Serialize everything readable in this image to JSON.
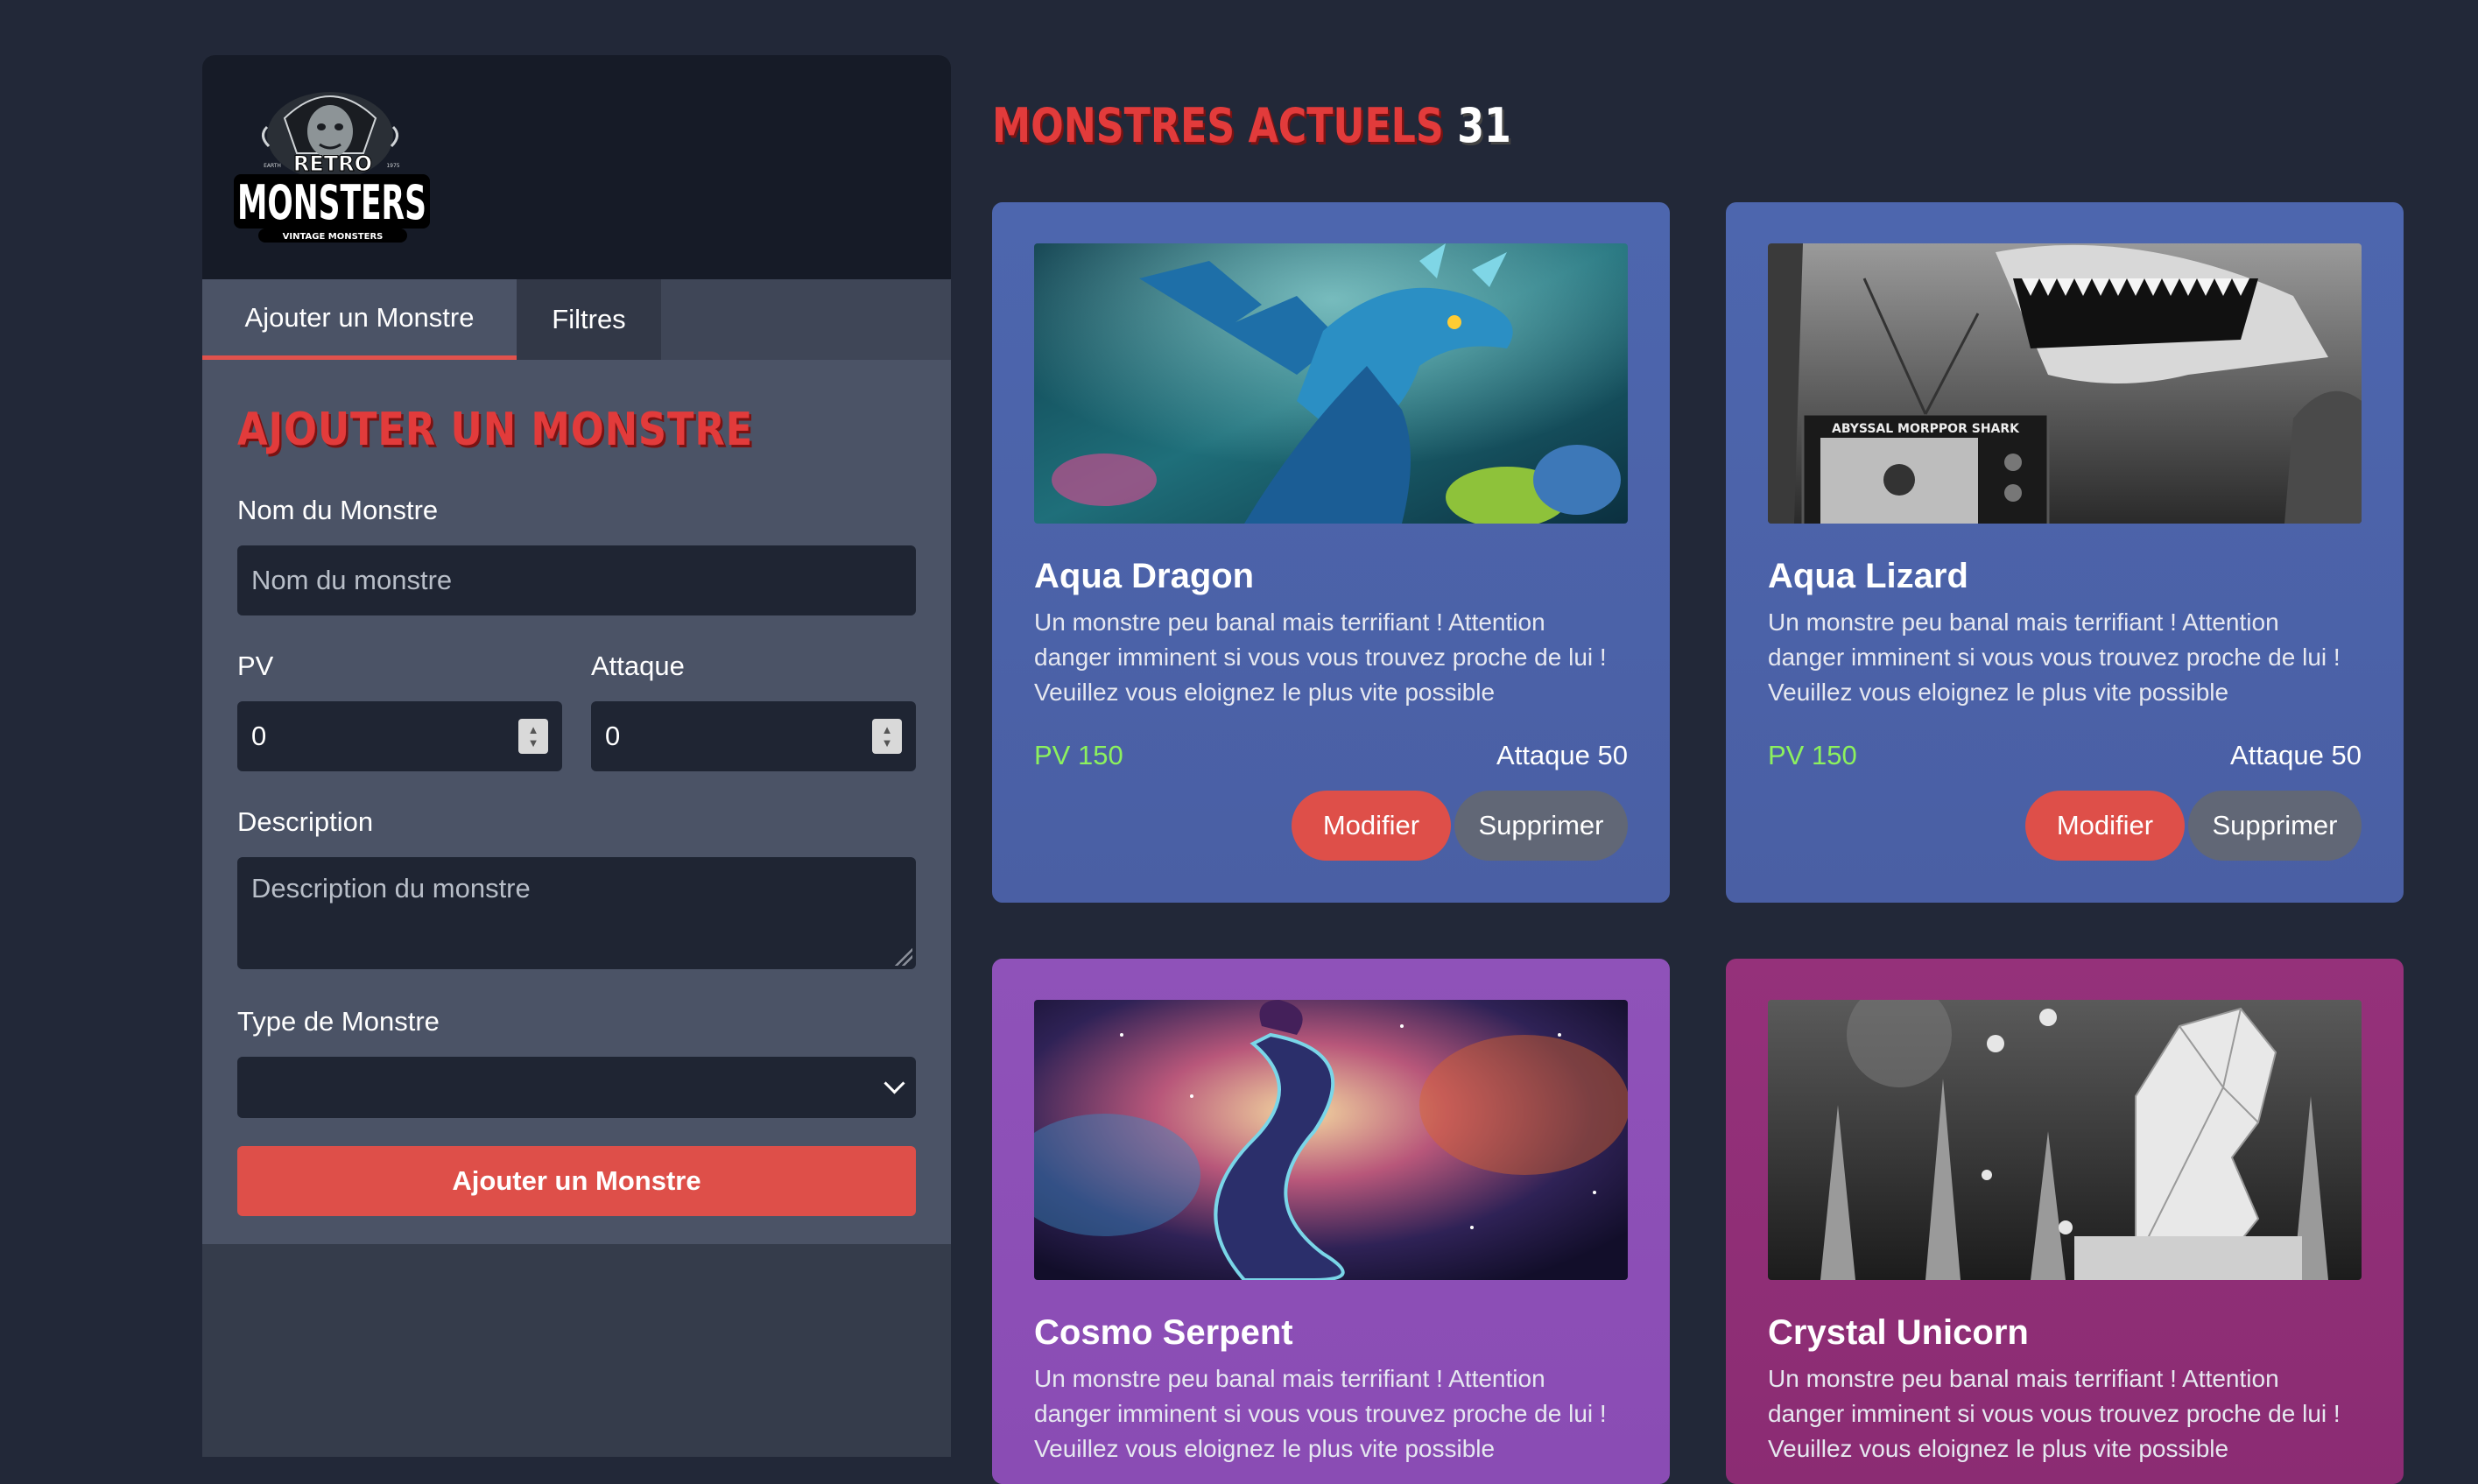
{
  "logo": {
    "top_text": "RETRO",
    "main_text": "MONSTERS",
    "sub_text": "VINTAGE MONSTERS",
    "left_small": "EARTH",
    "right_small": "1975"
  },
  "tabs": [
    {
      "label": "Ajouter un Monstre",
      "active": true
    },
    {
      "label": "Filtres",
      "active": false
    }
  ],
  "form": {
    "title": "Ajouter un Monstre",
    "name_label": "Nom du Monstre",
    "name_placeholder": "Nom du monstre",
    "pv_label": "PV",
    "pv_value": "0",
    "attack_label": "Attaque",
    "attack_value": "0",
    "description_label": "Description",
    "description_placeholder": "Description du monstre",
    "type_label": "Type de Monstre",
    "type_value": "",
    "submit_label": "Ajouter un Monstre"
  },
  "main": {
    "title": "Monstres actuels",
    "count": "31"
  },
  "cards": [
    {
      "name": "Aqua Dragon",
      "description": "Un monstre peu banal mais terrifiant ! Attention danger imminent si vous vous trouvez proche de lui ! Veuillez vous eloignez le plus vite possible",
      "pv": "PV 150",
      "attack": "Attaque 50",
      "edit_label": "Modifier",
      "delete_label": "Supprimer",
      "color": "#4d66ae"
    },
    {
      "name": "Aqua Lizard",
      "description": "Un monstre peu banal mais terrifiant ! Attention danger imminent si vous vous trouvez proche de lui ! Veuillez vous eloignez le plus vite possible",
      "pv": "PV 150",
      "attack": "Attaque 50",
      "edit_label": "Modifier",
      "delete_label": "Supprimer",
      "tv_text": "ABYSSAL MORPPOR SHARK",
      "color": "#4d66ae"
    },
    {
      "name": "Cosmo Serpent",
      "description": "Un monstre peu banal mais terrifiant ! Attention danger imminent si vous vous trouvez proche de lui ! Veuillez vous eloignez le plus vite possible",
      "color": "#8f52b9"
    },
    {
      "name": "Crystal Unicorn",
      "description": "Un monstre peu banal mais terrifiant ! Attention danger imminent si vous vous trouvez proche de lui ! Veuillez vous eloignez le plus vite possible",
      "color": "#95317a"
    }
  ]
}
